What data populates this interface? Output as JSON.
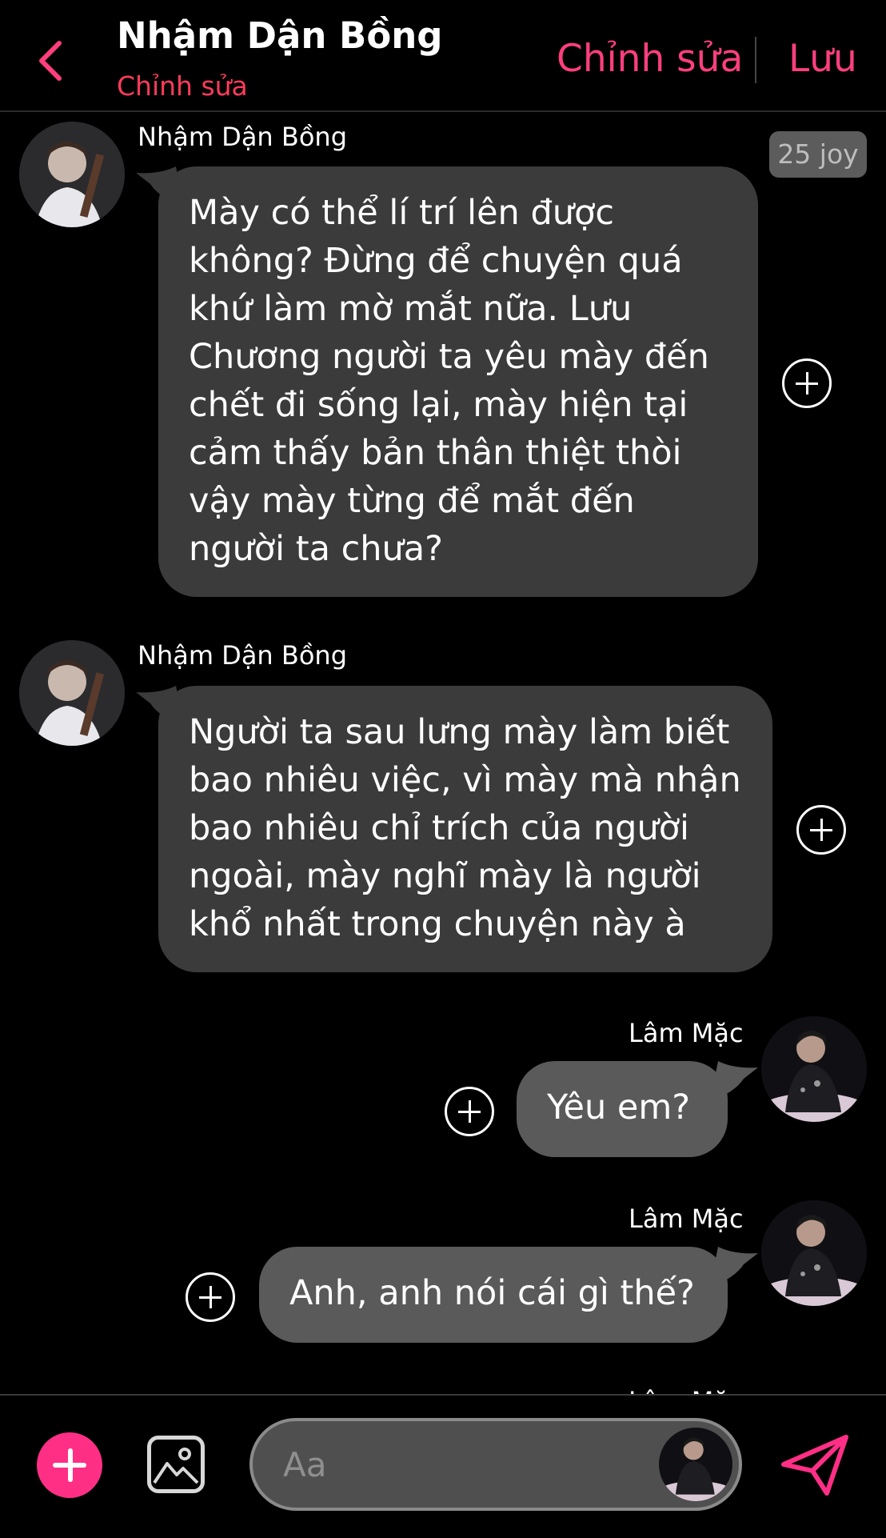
{
  "header": {
    "title": "Nhậm Dận Bồng",
    "subtitle": "Chỉnh sửa",
    "edit_label": "Chỉnh sửa",
    "save_label": "Lưu",
    "back_icon": "chevron-left-icon"
  },
  "badge": {
    "text": "25 joy"
  },
  "messages": [
    {
      "sender": "Nhậm Dận Bồng",
      "text": "Mày có thể lí trí lên được không? Đừng để chuyện quá khứ làm mờ mắt nữa. Lưu Chương người ta yêu mày đến chết đi sống lại, mày hiện tại cảm thấy bản thân thiệt thòi vậy mày từng để mắt đến người ta chưa?"
    },
    {
      "sender": "Nhậm Dận Bồng",
      "text": "Người ta sau lưng mày làm biết bao nhiêu việc, vì mày mà nhận bao nhiêu chỉ trích của người ngoài, mày nghĩ mày là người khổ nhất trong chuyện này à"
    },
    {
      "sender": "Lâm Mặc",
      "text": "Yêu em?"
    },
    {
      "sender": "Lâm Mặc",
      "text": "Anh, anh nói cái gì thế?"
    }
  ],
  "peek": {
    "sender": "Lâm Mặc"
  },
  "composer": {
    "placeholder": "Aa"
  },
  "colors": {
    "accent": "#ff3e7f",
    "subtitle": "#ff3b5c",
    "incoming_bubble": "#3b3b3b",
    "outgoing_bubble": "#5a5a5a",
    "add_button": "#ff2f86"
  }
}
